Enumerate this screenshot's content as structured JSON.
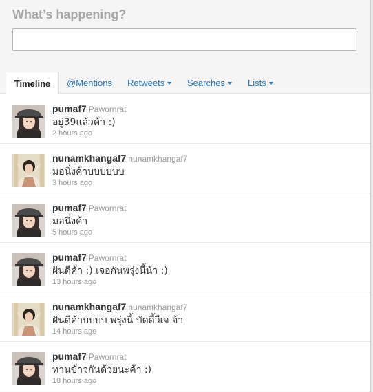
{
  "composer": {
    "title": "What’s happening?",
    "input_value": ""
  },
  "tabs": [
    {
      "label": "Timeline",
      "active": true,
      "has_dropdown": false
    },
    {
      "label": "@Mentions",
      "active": false,
      "has_dropdown": false
    },
    {
      "label": "Retweets",
      "active": false,
      "has_dropdown": true
    },
    {
      "label": "Searches",
      "active": false,
      "has_dropdown": true
    },
    {
      "label": "Lists",
      "active": false,
      "has_dropdown": true
    }
  ],
  "tweets": [
    {
      "username": "pumaf7",
      "display_name": "Pawornrat",
      "text": "อยู่39แล้วค้า :)",
      "time": "2 hours ago",
      "avatar": "pumaf7-avatar"
    },
    {
      "username": "nunamkhangaf7",
      "display_name": "nunamkhangaf7",
      "text": "มอนิ่งค้าบบบบบบ",
      "time": "3 hours ago",
      "avatar": "nunamkhangaf7-avatar"
    },
    {
      "username": "pumaf7",
      "display_name": "Pawornrat",
      "text": "มอนิ่งค้า",
      "time": "5 hours ago",
      "avatar": "pumaf7-avatar"
    },
    {
      "username": "pumaf7",
      "display_name": "Pawornrat",
      "text": "ฝันดีค้า :) เจอกันพรุ่งนี้น้า :)",
      "time": "13 hours ago",
      "avatar": "pumaf7-avatar"
    },
    {
      "username": "nunamkhangaf7",
      "display_name": "nunamkhangaf7",
      "text": "ฝันดีค้าบบบบ พรุ่งนี้ บัดดี้วีเจ จ้า",
      "time": "14 hours ago",
      "avatar": "nunamkhangaf7-avatar"
    },
    {
      "username": "pumaf7",
      "display_name": "Pawornrat",
      "text": "ทานข้าวกันด้วยนะค้า :)",
      "time": "18 hours ago",
      "avatar": "pumaf7-avatar"
    }
  ]
}
